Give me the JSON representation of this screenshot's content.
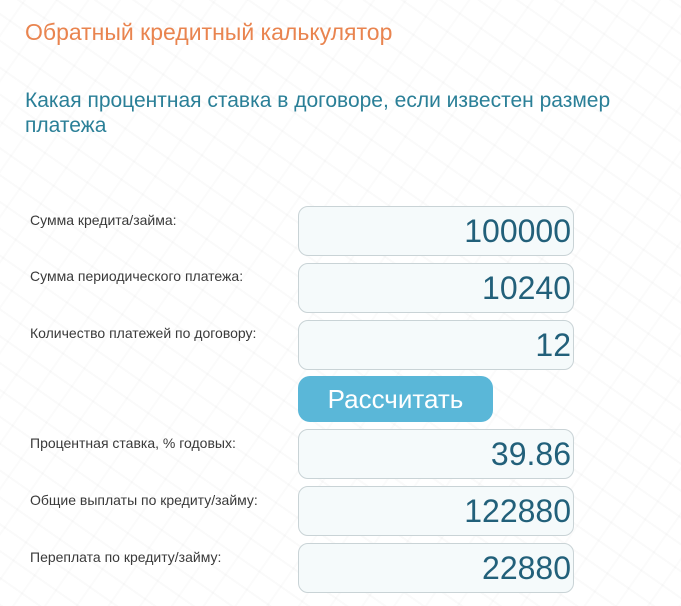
{
  "header": {
    "title": "Обратный кредитный калькулятор",
    "subtitle": "Какая процентная ставка в договоре, если известен размер платежа"
  },
  "inputs": [
    {
      "label": "Сумма кредита/займа:",
      "value": "100000"
    },
    {
      "label": "Сумма периодического платежа:",
      "value": "10240"
    },
    {
      "label": "Количество платежей по договору:",
      "value": "12"
    }
  ],
  "calculate_button": {
    "label": "Рассчитать"
  },
  "results": [
    {
      "label": "Процентная ставка, % годовых:",
      "value": "39.86"
    },
    {
      "label": "Общие выплаты по кредиту/займу:",
      "value": "122880"
    },
    {
      "label": "Переплата по кредиту/займу:",
      "value": "22880"
    }
  ],
  "colors": {
    "title": "#e9844f",
    "subtitle": "#2a7f97",
    "button": "#5ab7d8",
    "value_text": "#22607a"
  }
}
